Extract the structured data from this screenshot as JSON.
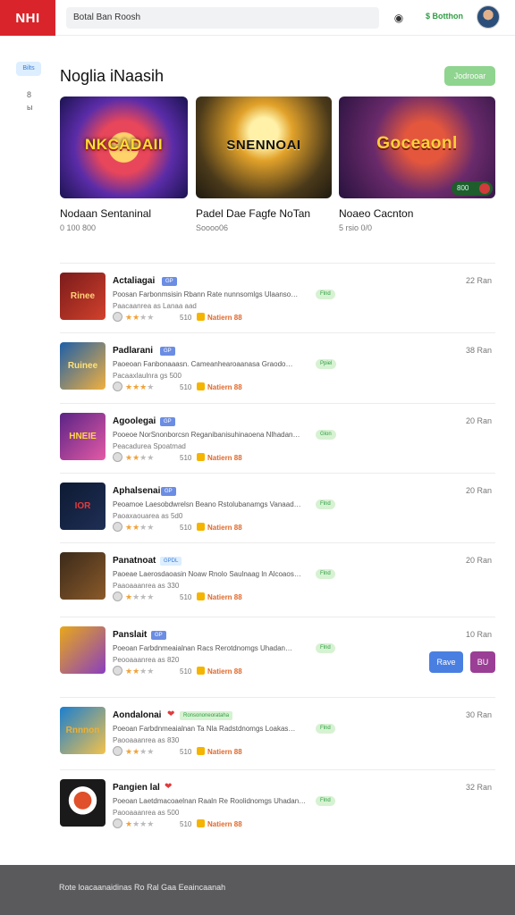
{
  "header": {
    "logo": "NHI",
    "search_value": "Botal Ban Roosh",
    "signin_label": "$ Botthon"
  },
  "sidebar": {
    "badge": "Bilts",
    "item_1": "8",
    "item_2": "ы"
  },
  "page": {
    "title": "Noglia iNaasih",
    "see_all_label": "Jodrooar"
  },
  "featured": [
    {
      "art_text": "NKCADAII",
      "name": "Nodaan Sentaninal",
      "meta": "0 100 800"
    },
    {
      "art_text": "SNENNOAI",
      "name": "Padel Dae Fagfe NoTan",
      "meta": "Soooo06"
    },
    {
      "art_text": "Goceaonl",
      "name": "Noaeo Cacnton",
      "meta": "5 rsio 0/0",
      "badge": "800"
    }
  ],
  "list": [
    {
      "title": "Actaliagai",
      "tag": "GP",
      "desc": "Poosan Farbonmsisin Rbann Rate nunnsomlgs Ulaanso…",
      "badge": "Flnd",
      "sub": "Paacaanrea as Lanaa aad",
      "count": "510",
      "publisher": "Natiern 88",
      "time": "22  Ran",
      "thumb_text": "Rinee",
      "stars": 2
    },
    {
      "title": "Padlarani",
      "tag": "GP",
      "desc": "Paoeoan Fanbonaaasn. Cameanhearoaanasa Graodo…",
      "badge": "Ppiel",
      "sub": "Pacaaxlaulnra gs 500",
      "count": "510",
      "publisher": "Natiern 88",
      "time": "38  Ran",
      "thumb_text": "Ruinee",
      "stars": 3
    },
    {
      "title": "Agoolegai",
      "tag": "GP",
      "desc": "Pooeoe NorSnonborcsn Reganibanisuhinaoena Nlhadan…",
      "badge": "Glon",
      "sub": "Peacadurea  Spoatmad",
      "count": "510",
      "publisher": "Natiern 88",
      "time": "20  Ran",
      "thumb_text": "HNEIE",
      "stars": 2
    },
    {
      "title": "Aphalsenai",
      "tag": "GP",
      "desc": "Peoamoe Laesobdwrelsn Beano Rstolubanamgs Vanaad…",
      "badge": "Flnd",
      "sub": "Paoaxaouarea as 5d0",
      "count": "510",
      "publisher": "Natiern 88",
      "time": "20  Ran",
      "thumb_text": "IOR",
      "stars": 2
    },
    {
      "title": "Panatnoat",
      "tag": "GPDL",
      "desc": "Paoeae Laerosdaoasin Noaw Rnolo Saulnaag ln Alcoaos…",
      "badge": "Flnd",
      "sub": "Paaoaaanrea as 330",
      "count": "510",
      "publisher": "Natiern 88",
      "time": "20  Ran",
      "thumb_text": "",
      "stars": 1
    },
    {
      "title": "Panslait",
      "tag": "GP",
      "desc": "Poeoan Farbdnmeaialnan Racs Rerotdnomgs Uhadan…",
      "badge": "Flnd",
      "sub": "Peooaaanrea as 820",
      "count": "510",
      "publisher": "Natiern 88",
      "time": "10  Ran",
      "thumb_text": "",
      "stars": 2,
      "action_a": "Rave",
      "action_b": "BU"
    },
    {
      "title": "Aondalonai",
      "tag": "Ronsononeorataha",
      "desc": "Poeoan Farbdnmeaialnan Ta Nla Radstdnomgs Loakas…",
      "badge": "Flnd",
      "sub": "Paooaaanrea as 830",
      "count": "510",
      "publisher": "Natiern 88",
      "time": "30  Ran",
      "thumb_text": "Rnnnon",
      "stars": 2
    },
    {
      "title": "Pangien lal",
      "tag": "",
      "desc": "Poeoan Laetdmacoaelnan Raaln Re Roolidnomgs Uhadan…",
      "badge": "Flnd",
      "sub": "Paooaaanrea as 500",
      "count": "510",
      "publisher": "Natiern 88",
      "time": "32  Ran",
      "thumb_text": "",
      "stars": 1
    }
  ],
  "footer": {
    "text": "Rote loacaanaidinas  Ro  Ral Gaa Eeaincaanah"
  }
}
